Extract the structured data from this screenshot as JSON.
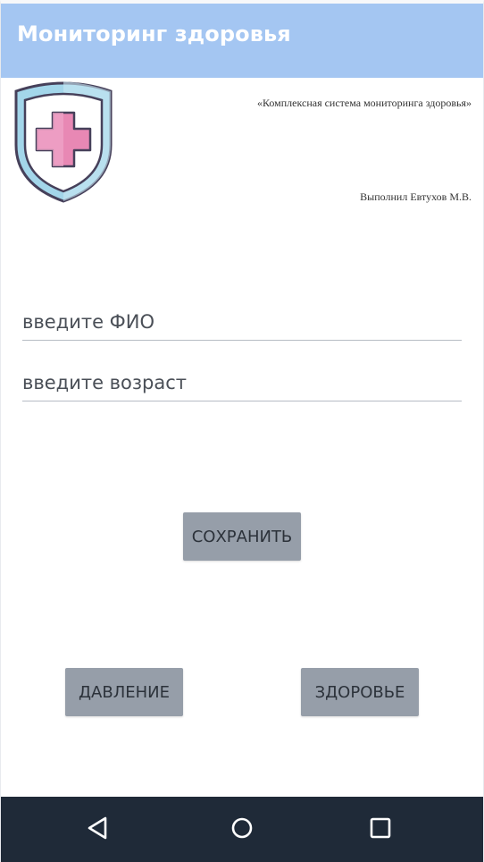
{
  "app_bar": {
    "title": "Мониторинг здоровья",
    "color": "#a4c6f2"
  },
  "header": {
    "logo_icon": "medical-shield-icon",
    "subtitle": "«Комплексная система мониторинга здоровья»",
    "author": "Выполнил Евтухов М.В."
  },
  "form": {
    "name_placeholder": "введите ФИО",
    "name_value": "",
    "age_placeholder": "введите возраст",
    "age_value": ""
  },
  "buttons": {
    "save_label": "СОХРАНИТЬ",
    "pressure_label": "ДАВЛЕНИЕ",
    "health_label": "ЗДОРОВЬЕ",
    "color": "#969ea9"
  },
  "nav_bar": {
    "color": "#1f2a38",
    "icons": [
      "back-triangle-icon",
      "home-circle-icon",
      "recent-apps-square-icon"
    ]
  }
}
